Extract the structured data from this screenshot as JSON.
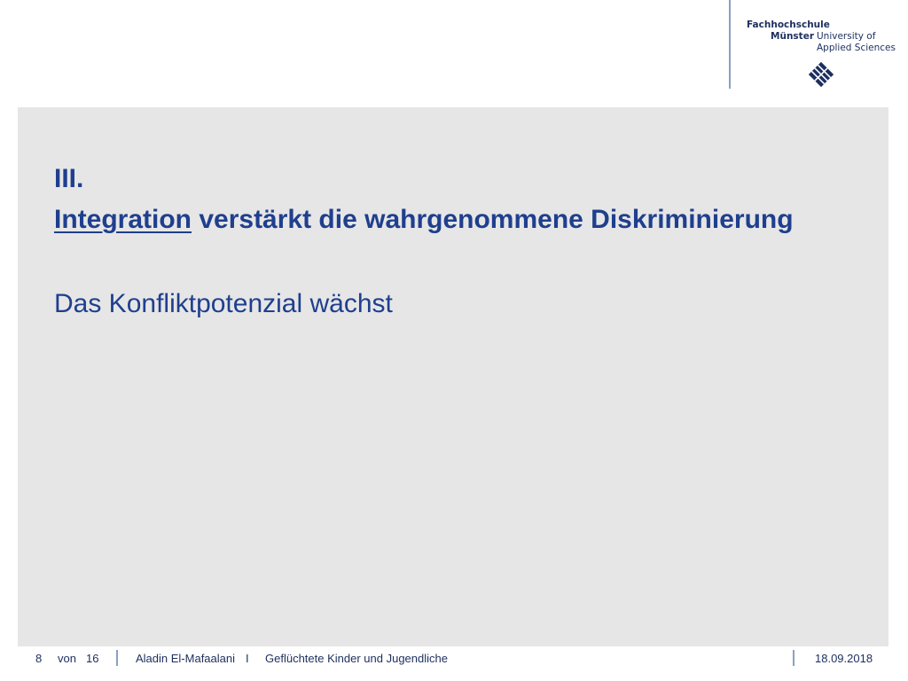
{
  "header": {
    "logo": {
      "line1": "Fachhochschule",
      "line2_left": "Münster",
      "line2_right": "University of",
      "line3": "Applied Sciences"
    }
  },
  "slide": {
    "title_line1": "III.",
    "title_underlined_word": "Integration",
    "title_rest": " verstärkt die wahrgenommene Diskriminierung",
    "subtitle": "Das Konfliktpotenzial wächst"
  },
  "footer": {
    "page_current": "8",
    "page_of": "von",
    "page_total": "16",
    "author": "Aladin El-Mafaalani",
    "divider": "I",
    "topic": "Geflüchtete Kinder und Jugendliche",
    "date": "18.09.2018"
  },
  "colors": {
    "primary_text": "#1f3f8e",
    "panel_background": "#e6e6e6",
    "rule": "#8aa0c2"
  }
}
